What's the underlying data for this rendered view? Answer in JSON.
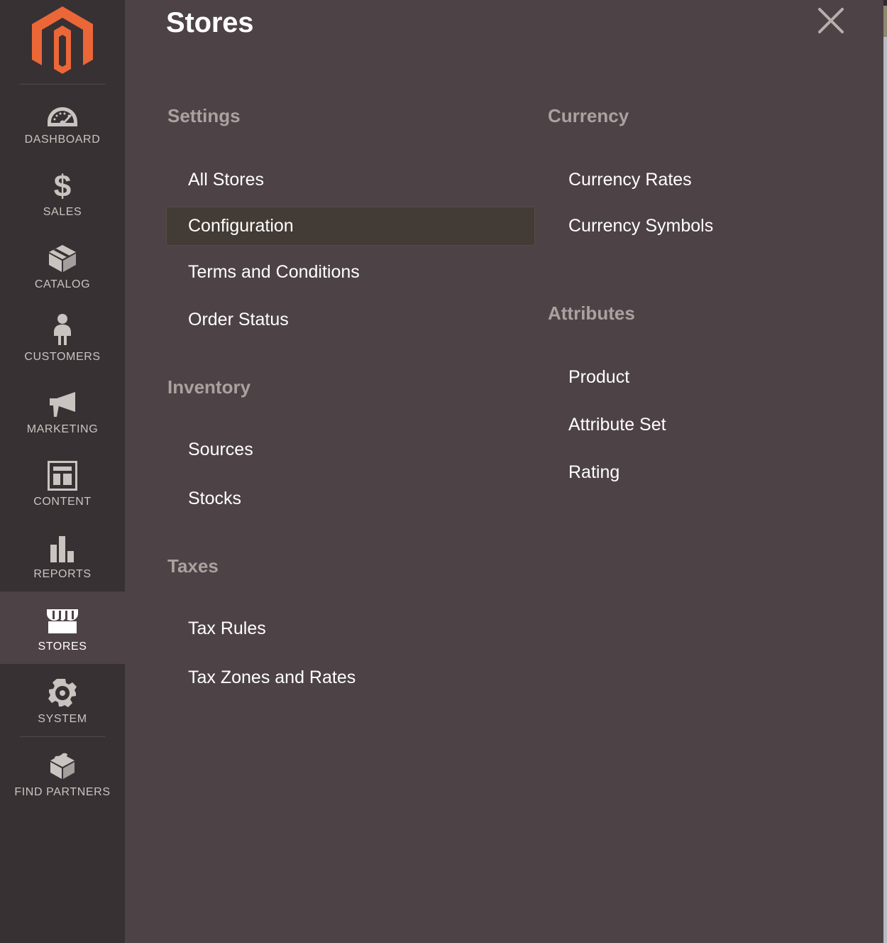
{
  "header": {
    "title": "Stores",
    "close_icon": "close-icon"
  },
  "sidebar": {
    "logo_icon": "magento-logo-icon",
    "items": [
      {
        "label": "DASHBOARD",
        "icon": "dashboard-gauge-icon",
        "active": false
      },
      {
        "label": "SALES",
        "icon": "dollar-sign-icon",
        "active": false
      },
      {
        "label": "CATALOG",
        "icon": "box-icon",
        "active": false
      },
      {
        "label": "CUSTOMERS",
        "icon": "person-icon",
        "active": false
      },
      {
        "label": "MARKETING",
        "icon": "megaphone-icon",
        "active": false
      },
      {
        "label": "CONTENT",
        "icon": "layout-page-icon",
        "active": false
      },
      {
        "label": "REPORTS",
        "icon": "bar-chart-icon",
        "active": false
      },
      {
        "label": "STORES",
        "icon": "storefront-icon",
        "active": true
      },
      {
        "label": "SYSTEM",
        "icon": "gear-icon",
        "active": false
      },
      {
        "label": "FIND PARTNERS",
        "icon": "extension-block-icon",
        "active": false
      }
    ]
  },
  "menu": {
    "left_column": [
      {
        "title": "Settings",
        "items": [
          {
            "label": "All Stores",
            "selected": false
          },
          {
            "label": "Configuration",
            "selected": true
          },
          {
            "label": "Terms and Conditions",
            "selected": false
          },
          {
            "label": "Order Status",
            "selected": false
          }
        ]
      },
      {
        "title": "Inventory",
        "items": [
          {
            "label": "Sources",
            "selected": false
          },
          {
            "label": "Stocks",
            "selected": false
          }
        ]
      },
      {
        "title": "Taxes",
        "items": [
          {
            "label": "Tax Rules",
            "selected": false
          },
          {
            "label": "Tax Zones and Rates",
            "selected": false
          }
        ]
      }
    ],
    "right_column": [
      {
        "title": "Currency",
        "items": [
          {
            "label": "Currency Rates",
            "selected": false
          },
          {
            "label": "Currency Symbols",
            "selected": false
          }
        ]
      },
      {
        "title": "Attributes",
        "items": [
          {
            "label": "Product",
            "selected": false
          },
          {
            "label": "Attribute Set",
            "selected": false
          },
          {
            "label": "Rating",
            "selected": false
          }
        ]
      }
    ]
  },
  "colors": {
    "sidebar_bg": "#373134",
    "panel_bg": "#4D4246",
    "selected_item_bg": "#433B35",
    "group_title": "#a9a29e",
    "item_text": "#ffffff",
    "brand_orange": "#ec6737"
  }
}
